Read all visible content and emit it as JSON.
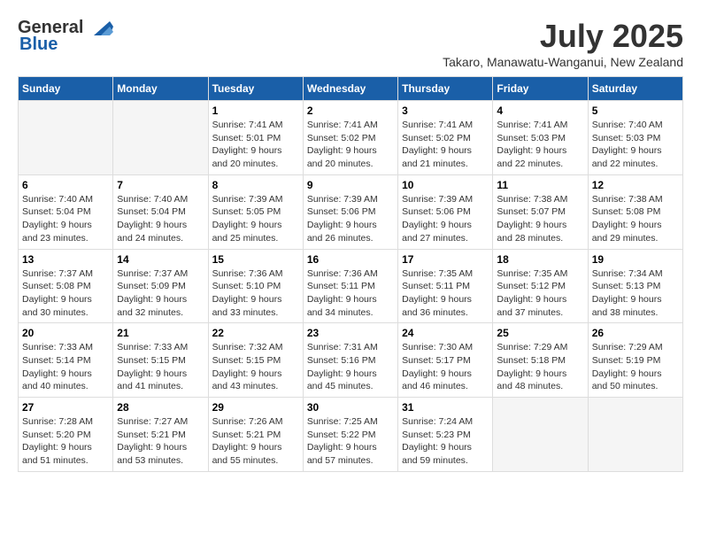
{
  "header": {
    "logo_general": "General",
    "logo_blue": "Blue",
    "month_year": "July 2025",
    "location": "Takaro, Manawatu-Wanganui, New Zealand"
  },
  "weekdays": [
    "Sunday",
    "Monday",
    "Tuesday",
    "Wednesday",
    "Thursday",
    "Friday",
    "Saturday"
  ],
  "weeks": [
    [
      {
        "day": "",
        "sunrise": "",
        "sunset": "",
        "daylight": ""
      },
      {
        "day": "",
        "sunrise": "",
        "sunset": "",
        "daylight": ""
      },
      {
        "day": "1",
        "sunrise": "Sunrise: 7:41 AM",
        "sunset": "Sunset: 5:01 PM",
        "daylight": "Daylight: 9 hours and 20 minutes."
      },
      {
        "day": "2",
        "sunrise": "Sunrise: 7:41 AM",
        "sunset": "Sunset: 5:02 PM",
        "daylight": "Daylight: 9 hours and 20 minutes."
      },
      {
        "day": "3",
        "sunrise": "Sunrise: 7:41 AM",
        "sunset": "Sunset: 5:02 PM",
        "daylight": "Daylight: 9 hours and 21 minutes."
      },
      {
        "day": "4",
        "sunrise": "Sunrise: 7:41 AM",
        "sunset": "Sunset: 5:03 PM",
        "daylight": "Daylight: 9 hours and 22 minutes."
      },
      {
        "day": "5",
        "sunrise": "Sunrise: 7:40 AM",
        "sunset": "Sunset: 5:03 PM",
        "daylight": "Daylight: 9 hours and 22 minutes."
      }
    ],
    [
      {
        "day": "6",
        "sunrise": "Sunrise: 7:40 AM",
        "sunset": "Sunset: 5:04 PM",
        "daylight": "Daylight: 9 hours and 23 minutes."
      },
      {
        "day": "7",
        "sunrise": "Sunrise: 7:40 AM",
        "sunset": "Sunset: 5:04 PM",
        "daylight": "Daylight: 9 hours and 24 minutes."
      },
      {
        "day": "8",
        "sunrise": "Sunrise: 7:39 AM",
        "sunset": "Sunset: 5:05 PM",
        "daylight": "Daylight: 9 hours and 25 minutes."
      },
      {
        "day": "9",
        "sunrise": "Sunrise: 7:39 AM",
        "sunset": "Sunset: 5:06 PM",
        "daylight": "Daylight: 9 hours and 26 minutes."
      },
      {
        "day": "10",
        "sunrise": "Sunrise: 7:39 AM",
        "sunset": "Sunset: 5:06 PM",
        "daylight": "Daylight: 9 hours and 27 minutes."
      },
      {
        "day": "11",
        "sunrise": "Sunrise: 7:38 AM",
        "sunset": "Sunset: 5:07 PM",
        "daylight": "Daylight: 9 hours and 28 minutes."
      },
      {
        "day": "12",
        "sunrise": "Sunrise: 7:38 AM",
        "sunset": "Sunset: 5:08 PM",
        "daylight": "Daylight: 9 hours and 29 minutes."
      }
    ],
    [
      {
        "day": "13",
        "sunrise": "Sunrise: 7:37 AM",
        "sunset": "Sunset: 5:08 PM",
        "daylight": "Daylight: 9 hours and 30 minutes."
      },
      {
        "day": "14",
        "sunrise": "Sunrise: 7:37 AM",
        "sunset": "Sunset: 5:09 PM",
        "daylight": "Daylight: 9 hours and 32 minutes."
      },
      {
        "day": "15",
        "sunrise": "Sunrise: 7:36 AM",
        "sunset": "Sunset: 5:10 PM",
        "daylight": "Daylight: 9 hours and 33 minutes."
      },
      {
        "day": "16",
        "sunrise": "Sunrise: 7:36 AM",
        "sunset": "Sunset: 5:11 PM",
        "daylight": "Daylight: 9 hours and 34 minutes."
      },
      {
        "day": "17",
        "sunrise": "Sunrise: 7:35 AM",
        "sunset": "Sunset: 5:11 PM",
        "daylight": "Daylight: 9 hours and 36 minutes."
      },
      {
        "day": "18",
        "sunrise": "Sunrise: 7:35 AM",
        "sunset": "Sunset: 5:12 PM",
        "daylight": "Daylight: 9 hours and 37 minutes."
      },
      {
        "day": "19",
        "sunrise": "Sunrise: 7:34 AM",
        "sunset": "Sunset: 5:13 PM",
        "daylight": "Daylight: 9 hours and 38 minutes."
      }
    ],
    [
      {
        "day": "20",
        "sunrise": "Sunrise: 7:33 AM",
        "sunset": "Sunset: 5:14 PM",
        "daylight": "Daylight: 9 hours and 40 minutes."
      },
      {
        "day": "21",
        "sunrise": "Sunrise: 7:33 AM",
        "sunset": "Sunset: 5:15 PM",
        "daylight": "Daylight: 9 hours and 41 minutes."
      },
      {
        "day": "22",
        "sunrise": "Sunrise: 7:32 AM",
        "sunset": "Sunset: 5:15 PM",
        "daylight": "Daylight: 9 hours and 43 minutes."
      },
      {
        "day": "23",
        "sunrise": "Sunrise: 7:31 AM",
        "sunset": "Sunset: 5:16 PM",
        "daylight": "Daylight: 9 hours and 45 minutes."
      },
      {
        "day": "24",
        "sunrise": "Sunrise: 7:30 AM",
        "sunset": "Sunset: 5:17 PM",
        "daylight": "Daylight: 9 hours and 46 minutes."
      },
      {
        "day": "25",
        "sunrise": "Sunrise: 7:29 AM",
        "sunset": "Sunset: 5:18 PM",
        "daylight": "Daylight: 9 hours and 48 minutes."
      },
      {
        "day": "26",
        "sunrise": "Sunrise: 7:29 AM",
        "sunset": "Sunset: 5:19 PM",
        "daylight": "Daylight: 9 hours and 50 minutes."
      }
    ],
    [
      {
        "day": "27",
        "sunrise": "Sunrise: 7:28 AM",
        "sunset": "Sunset: 5:20 PM",
        "daylight": "Daylight: 9 hours and 51 minutes."
      },
      {
        "day": "28",
        "sunrise": "Sunrise: 7:27 AM",
        "sunset": "Sunset: 5:21 PM",
        "daylight": "Daylight: 9 hours and 53 minutes."
      },
      {
        "day": "29",
        "sunrise": "Sunrise: 7:26 AM",
        "sunset": "Sunset: 5:21 PM",
        "daylight": "Daylight: 9 hours and 55 minutes."
      },
      {
        "day": "30",
        "sunrise": "Sunrise: 7:25 AM",
        "sunset": "Sunset: 5:22 PM",
        "daylight": "Daylight: 9 hours and 57 minutes."
      },
      {
        "day": "31",
        "sunrise": "Sunrise: 7:24 AM",
        "sunset": "Sunset: 5:23 PM",
        "daylight": "Daylight: 9 hours and 59 minutes."
      },
      {
        "day": "",
        "sunrise": "",
        "sunset": "",
        "daylight": ""
      },
      {
        "day": "",
        "sunrise": "",
        "sunset": "",
        "daylight": ""
      }
    ]
  ]
}
